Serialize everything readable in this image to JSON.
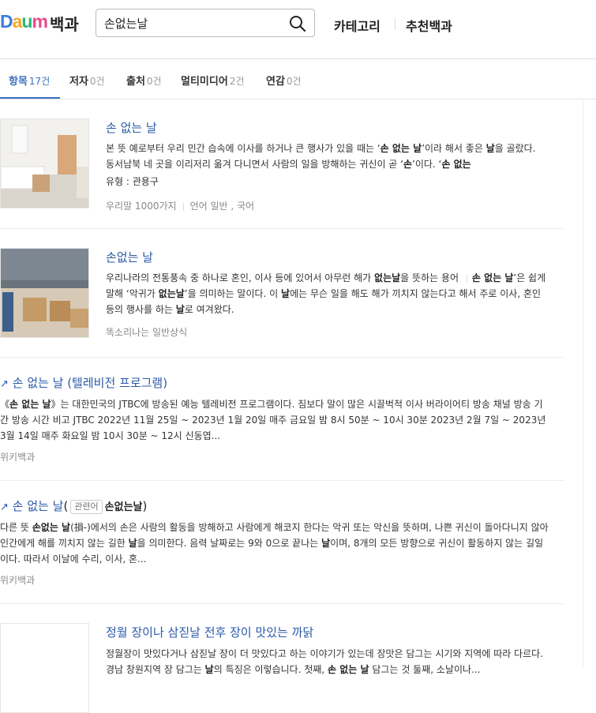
{
  "header": {
    "logo_text": "Daum",
    "service_name": "백과",
    "search_value": "손없는날",
    "nav": [
      "카테고리",
      "추천백과"
    ]
  },
  "tabs": [
    {
      "label": "항목",
      "count": "17건"
    },
    {
      "label": "저자",
      "count": "0건"
    },
    {
      "label": "출처",
      "count": "0건"
    },
    {
      "label": "멀티미디어",
      "count": "2건"
    },
    {
      "label": "연감",
      "count": "0건"
    }
  ],
  "results": [
    {
      "title": "손 없는 날",
      "desc_parts": [
        "본 뜻 예로부터 우리 민간 습속에 이사를 하거나 큰 행사가 있을 때는 ‘",
        "손 없는 날",
        "’이라 해서 좋은 ",
        "날",
        "을 골랐다. 동서남북 네 곳을 이리저리 옮겨 다니면서 사람의 일을 방해하는 귀신이 곧 ‘",
        "손",
        "’이다. ‘",
        "손 없는",
        ""
      ],
      "sub": "유형 : 관용구",
      "meta": [
        "우리말 1000가지",
        "언어 일반 , 국어"
      ]
    },
    {
      "title": "손없는 날",
      "desc_parts": [
        "우리나라의 전통풍속 중 하나로 혼인, 이사 등에 있어서 아무런 해가 ",
        "없는날",
        "을 뜻하는 용어 ",
        "손 없는 날",
        "’은 쉽게 말해 ‘악귀가 ",
        "없는날",
        "’을 의미하는 말이다. 이 ",
        "날",
        "에는 무슨 일을 해도 해가 끼치지 않는다고 해서 주로 이사, 혼인 등의 행사를 하는 ",
        "날",
        "로 여겨왔다."
      ],
      "meta": [
        "똑소리나는 일반상식"
      ]
    },
    {
      "title": "손 없는 날 (텔레비전 프로그램)",
      "desc_parts": [
        "《",
        "손 없는 날",
        "》는 대한민국의 JTBC에 방송된 예능 텔레비전 프로그램이다. 짐보다 말이 많은 시끌벅적 이사 버라이어티 방송 채널 방송 기간 방송 시간 비고 JTBC 2022년 11월 25일 ~ 2023년 1월 20일 매주 금요일 밤 8시 50분 ~ 10시 30분 2023년 2월 7일 ~ 2023년 3월 14일 매주 화요일 밤 10시 30분 ~ 12시 신동엽..."
      ],
      "meta": [
        "위키백과"
      ]
    },
    {
      "title": "손 없는 날",
      "related_badge": "관련어",
      "related_word": "손없는날",
      "desc_parts": [
        "다른 뜻 ",
        "손없는 날",
        "(損-)에서의 손은 사람의 활동을 방해하고 사람에게 해코지 한다는 악귀 또는 악신을 뜻하며, 나쁜 귀신이 돌아다니지 않아 인간에게 해를 끼치지 않는 길한 ",
        "날",
        "을 의미한다. 음력 날짜로는 9와 0으로 끝나는 ",
        "날",
        "이며, 8개의 모든 방향으로 귀신이 활동하지 않는 길일이다. 따라서 이날에 수리, 이사, 혼..."
      ],
      "meta": [
        "위키백과"
      ]
    },
    {
      "title": "정월 장이나 삼짇날 전후 장이 맛있는 까닭",
      "desc_parts": [
        "정월장이 맛있다거나 삼짇날 장이 더 맛있다고 하는 이야기가 있는데 장맛은 담그는 시기와 지역에 따라 다르다. 경남 창원지역 장 담그는 ",
        "날",
        "의 특징은 이렇습니다. 첫째, ",
        "손 없는 날",
        " 담그는 것 둘째, 소날이나..."
      ]
    }
  ]
}
